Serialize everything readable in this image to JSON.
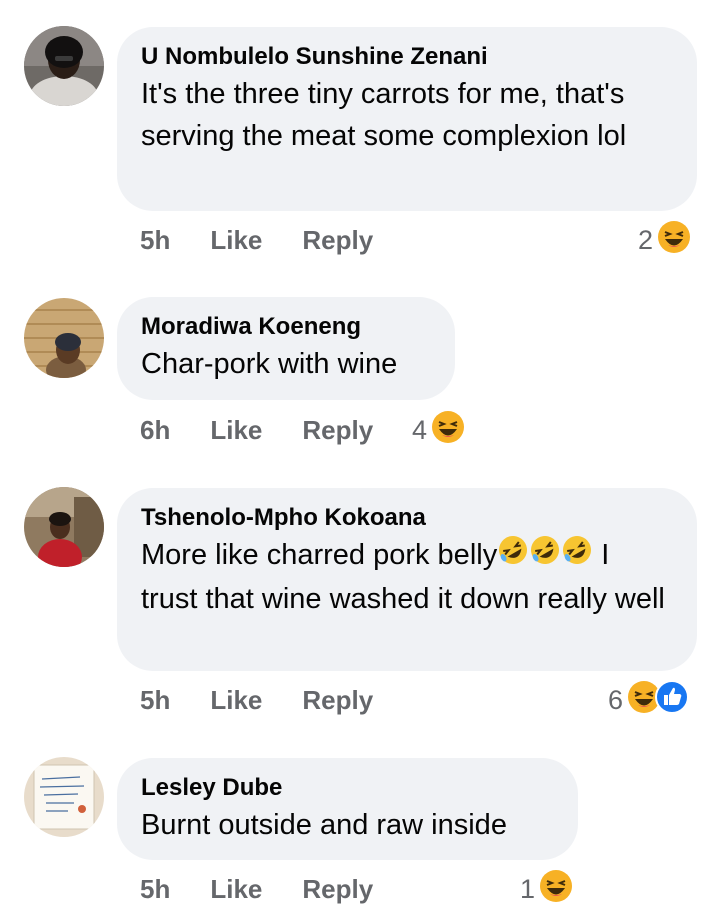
{
  "comments": [
    {
      "author": "U Nombulelo Sunshine Zenani",
      "text": "It's the three tiny carrots for me, that's serving the meat some complexion lol",
      "time": "5h",
      "like": "Like",
      "reply": "Reply",
      "reaction_count": "2",
      "reactions": [
        "haha-icon"
      ]
    },
    {
      "author": "Moradiwa Koeneng",
      "text": "Char-pork with wine",
      "time": "6h",
      "like": "Like",
      "reply": "Reply",
      "reaction_count": "4",
      "reactions": [
        "haha-icon"
      ]
    },
    {
      "author": "Tshenolo-Mpho Kokoana",
      "text_before": "More like charred pork belly",
      "text_after": " I trust that wine washed it down really well",
      "time": "5h",
      "like": "Like",
      "reply": "Reply",
      "reaction_count": "6",
      "reactions": [
        "haha-icon",
        "like-icon"
      ]
    },
    {
      "author": "Lesley Dube",
      "text": "Burnt outside and raw inside",
      "time": "5h",
      "like": "Like",
      "reply": "Reply",
      "reaction_count": "1",
      "reactions": [
        "haha-icon"
      ]
    }
  ],
  "colors": {
    "bubble": "#f0f2f5",
    "meta_text": "#65676b",
    "haha": "#f7b125",
    "like_blue": "#1877f2"
  }
}
